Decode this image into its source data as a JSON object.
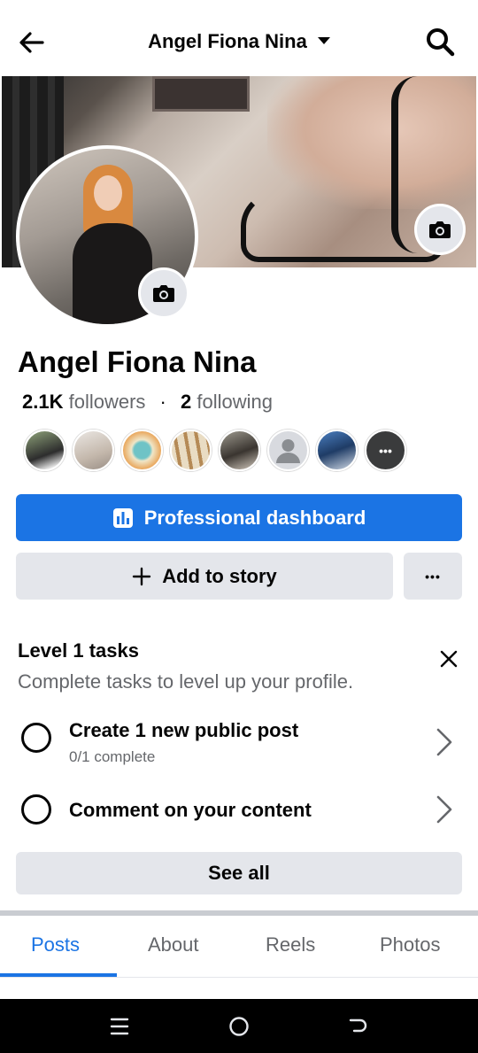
{
  "header": {
    "title": "Angel Fiona Nina"
  },
  "profile": {
    "name": "Angel Fiona Nina",
    "followers_count": "2.1K",
    "followers_label": "followers",
    "separator": "·",
    "following_count": "2",
    "following_label": "following",
    "friends_more_label": "•••"
  },
  "actions": {
    "dashboard_label": "Professional dashboard",
    "add_story_label": "Add to story",
    "more_label": "•••"
  },
  "tasks": {
    "title": "Level 1 tasks",
    "subtitle": "Complete tasks to level up your profile.",
    "items": [
      {
        "label": "Create 1 new public post",
        "meta": "0/1 complete"
      },
      {
        "label": "Comment on your content",
        "meta": ""
      }
    ],
    "see_all_label": "See all"
  },
  "tabs": [
    {
      "label": "Posts",
      "active": true
    },
    {
      "label": "About"
    },
    {
      "label": "Reels"
    },
    {
      "label": "Photos"
    }
  ],
  "colors": {
    "accent": "#1b74e4",
    "button_gray": "#e4e6eb",
    "text_secondary": "#65676b"
  },
  "icons": [
    "back-arrow-icon",
    "dropdown-caret-icon",
    "search-icon",
    "camera-icon",
    "dashboard-chart-icon",
    "plus-icon",
    "close-icon",
    "chevron-right-icon",
    "menu-lines-icon",
    "home-circle-icon",
    "back-nav-icon"
  ]
}
